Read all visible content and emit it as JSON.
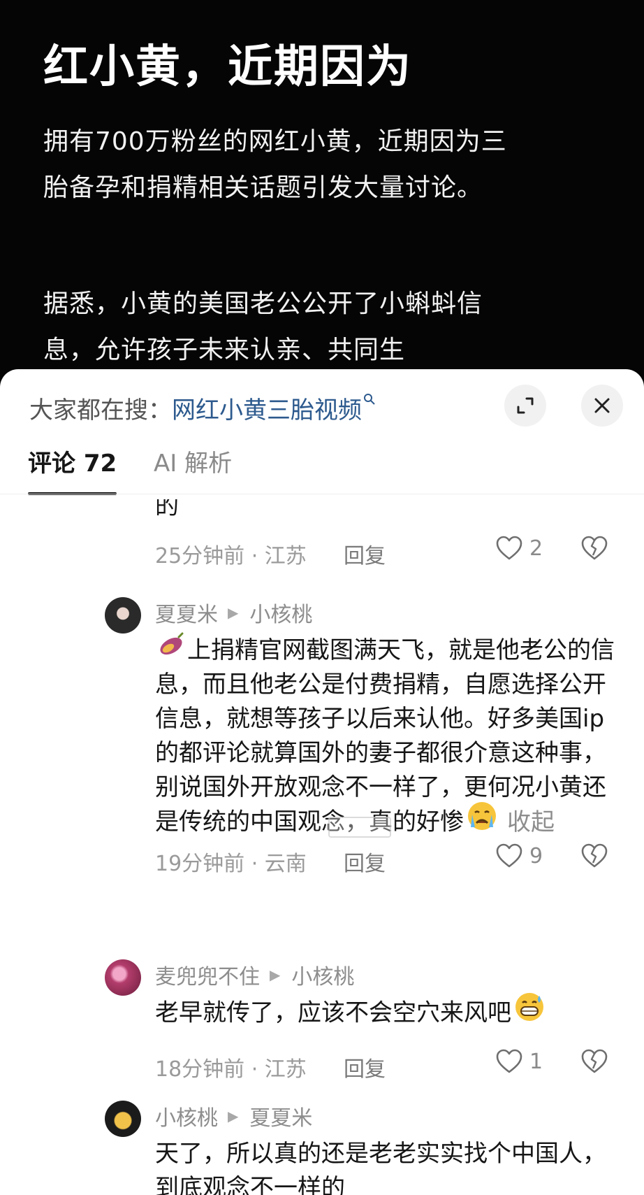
{
  "article": {
    "title": "红小黄，近期因为",
    "paragraph1": "拥有700万粉丝的网红小黄，近期因为三胎备孕和捐精相关话题引发大量讨论。",
    "paragraph2": "据悉，小黄的美国老公公开了小蝌蚪信息，允许孩子未来认亲、共同生"
  },
  "sheet": {
    "search_prefix": "大家都在搜：",
    "search_query": "网红小黄三胎视频",
    "expand_icon": "expand-icon",
    "close_icon": "close-icon",
    "tabs": [
      {
        "label": "评论 72",
        "active": true
      },
      {
        "label": "AI 解析",
        "active": false
      }
    ]
  },
  "comments": [
    {
      "cut_text": "的",
      "time_location": "25分钟前 · 江苏",
      "reply_label": "回复",
      "likes": "2"
    },
    {
      "author": "夏夏米",
      "reply_to": "小核桃",
      "emoji_lead": "sweet-potato-emoji",
      "text_main": "上捐精官网截图满天飞，就是他老公的信息，而且他老公是付费捐精，自愿选择公开信息，就想等孩子以后来认他。好多美国ip的都评论就算国外的妻子都很介意这种事，别说国外开放观念不一样了，更何况小黄还是传统的中国观念，真的好惨",
      "emoji_trail": "crying-face-emoji",
      "fold_label": "收起",
      "time_location": "19分钟前 · 云南",
      "reply_label": "回复",
      "likes": "9"
    },
    {
      "author": "麦兜兜不住",
      "reply_to": "小核桃",
      "text_main": "老早就传了，应该不会空穴来风吧",
      "emoji_trail": "grinning-sweat-emoji",
      "time_location": "18分钟前 · 江苏",
      "reply_label": "回复",
      "likes": "1"
    },
    {
      "author": "小核桃",
      "reply_to": "夏夏米",
      "text_main": "天了，所以真的还是老老实实找个中国人，到底观念不一样的"
    }
  ]
}
